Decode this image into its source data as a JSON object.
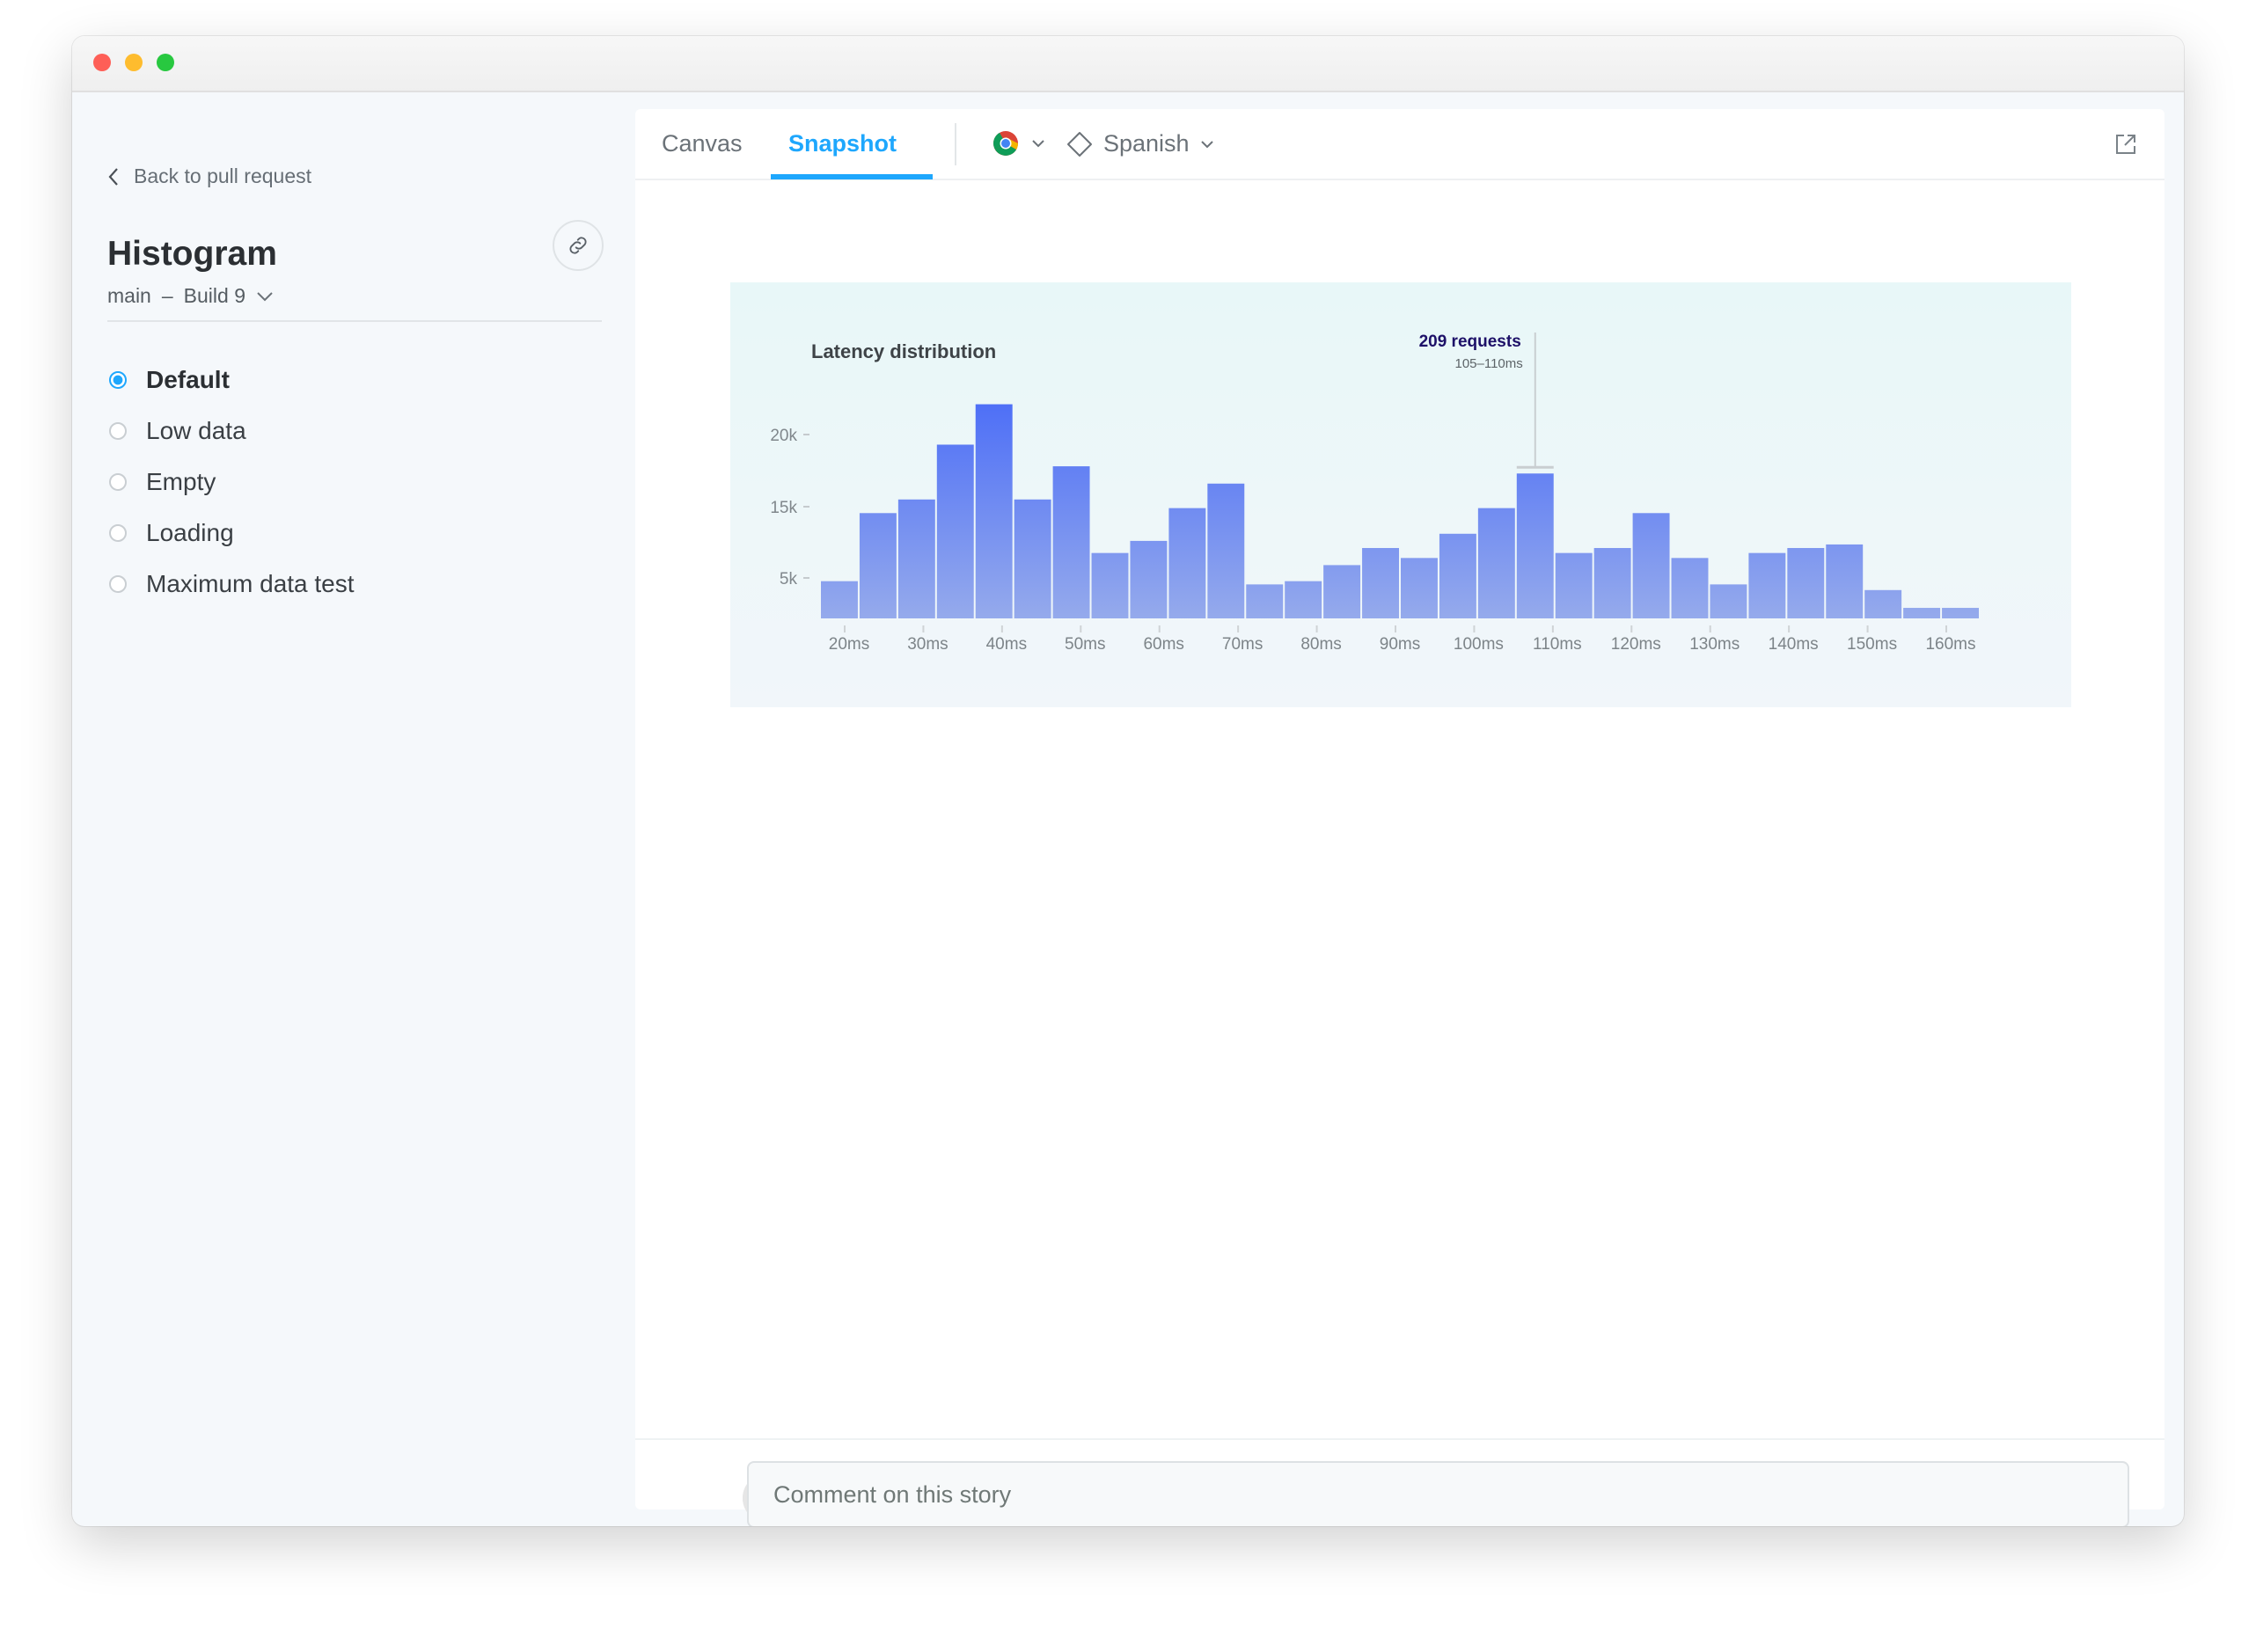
{
  "sidebar": {
    "back_label": "Back to pull request",
    "title": "Histogram",
    "branch": "main",
    "separator": "–",
    "build": "Build 9",
    "stories": [
      {
        "label": "Default",
        "selected": true
      },
      {
        "label": "Low data",
        "selected": false
      },
      {
        "label": "Empty",
        "selected": false
      },
      {
        "label": "Loading",
        "selected": false
      },
      {
        "label": "Maximum data test",
        "selected": false
      }
    ]
  },
  "toolbar": {
    "tabs": [
      {
        "label": "Canvas",
        "active": false
      },
      {
        "label": "Snapshot",
        "active": true
      }
    ],
    "browser_icon": "chrome-icon",
    "locale": "Spanish",
    "accent": "#1ea7fd"
  },
  "chart_data": {
    "type": "bar",
    "title": "Latency distribution",
    "y_ticks": [
      {
        "label": "20k",
        "value": 20000
      },
      {
        "label": "15k",
        "value": 15000
      },
      {
        "label": "5k",
        "value": 5000
      }
    ],
    "x_ticks": [
      "20ms",
      "30ms",
      "40ms",
      "50ms",
      "60ms",
      "70ms",
      "80ms",
      "90ms",
      "100ms",
      "110ms",
      "120ms",
      "130ms",
      "140ms",
      "150ms",
      "160ms"
    ],
    "values": [
      4600,
      14100,
      15500,
      19300,
      22100,
      15500,
      17800,
      8500,
      10200,
      14800,
      16600,
      4200,
      4600,
      6800,
      9200,
      7800,
      11200,
      14800,
      17300,
      8500,
      9200,
      14100,
      7800,
      4200,
      8500,
      9200,
      9700,
      3500,
      1300,
      1300
    ],
    "highlight_index": 18,
    "tooltip": {
      "title": "209 requests",
      "range": "105–110ms"
    },
    "bar_color_top": "#4a6cf7",
    "bar_color_bottom": "#95aaec",
    "grid": false
  },
  "comment": {
    "placeholder": "Comment on this story"
  }
}
